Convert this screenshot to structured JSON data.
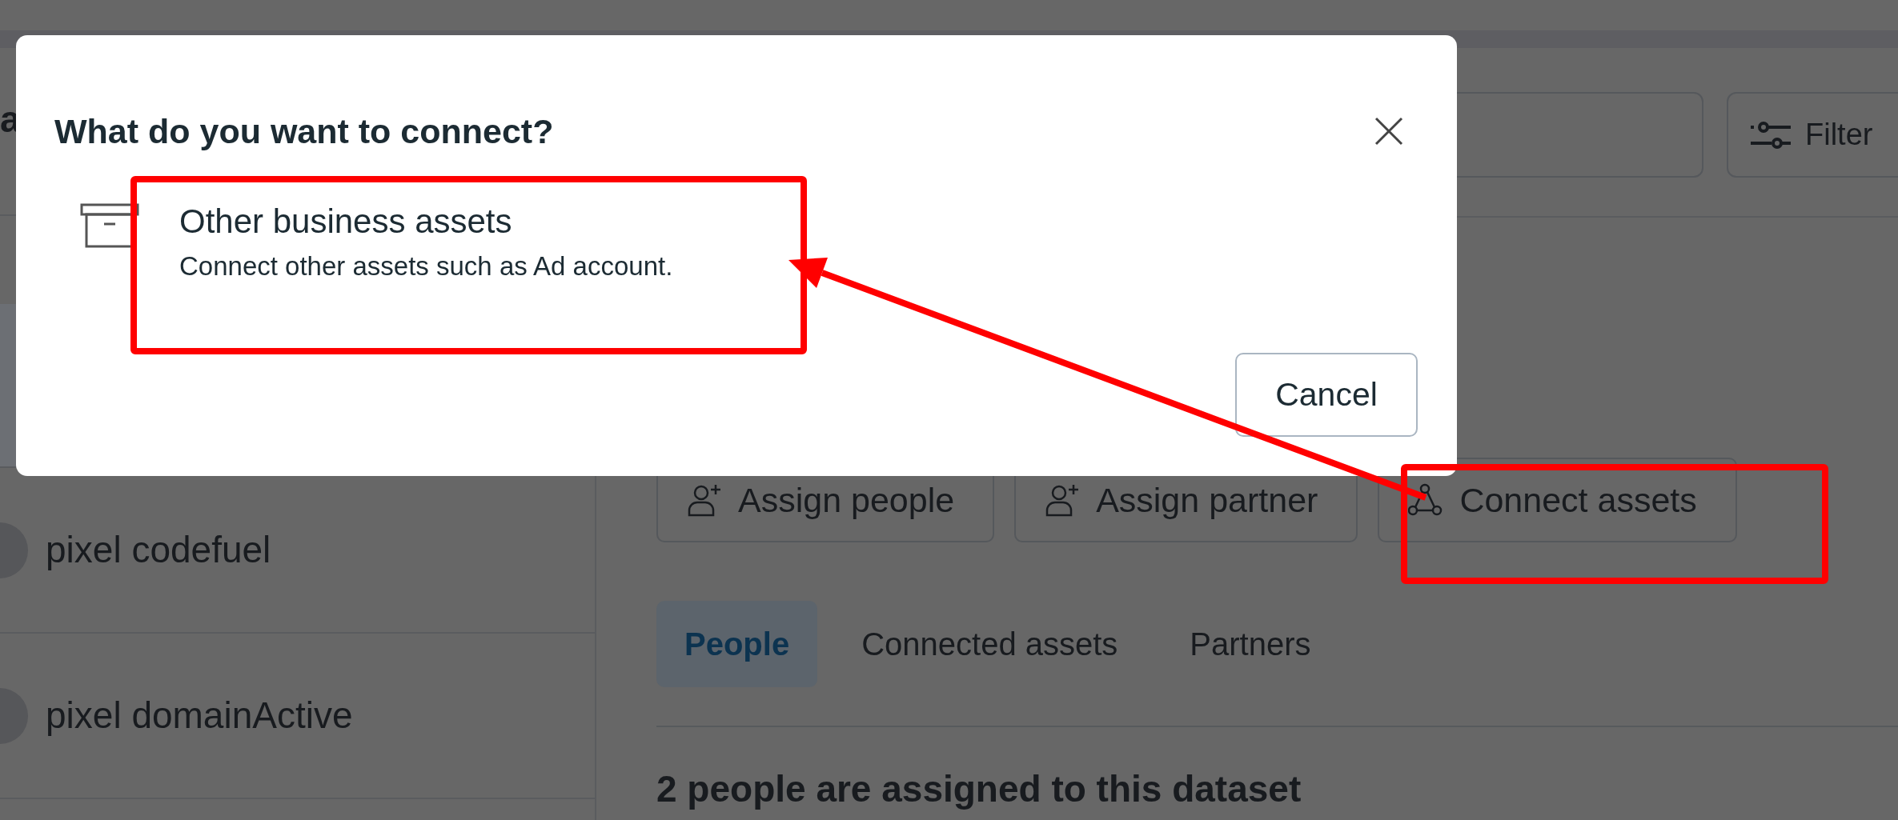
{
  "background": {
    "left_fragments": [
      "a"
    ],
    "list_items": [
      {
        "selected": true
      },
      {
        "label": "pixel codefuel",
        "selected": false
      },
      {
        "label": "pixel domainActive",
        "selected": false
      }
    ],
    "filters_button": "Filter",
    "actions": [
      {
        "kind": "person",
        "label": "Assign people"
      },
      {
        "kind": "person",
        "label": "Assign partner"
      },
      {
        "kind": "network",
        "label": "Connect assets"
      }
    ],
    "tabs": [
      {
        "label": "People",
        "selected": true
      },
      {
        "label": "Connected assets",
        "selected": false
      },
      {
        "label": "Partners",
        "selected": false
      }
    ],
    "section_heading": "2 people are assigned to this dataset"
  },
  "dialog": {
    "title": "What do you want to connect?",
    "options": [
      {
        "title": "Other business assets",
        "description": "Connect other assets such as Ad account."
      }
    ],
    "buttons": [
      "Cancel"
    ]
  },
  "annotations": [
    {
      "kind": "box"
    },
    {
      "kind": "box"
    },
    {
      "kind": "arrow"
    }
  ]
}
